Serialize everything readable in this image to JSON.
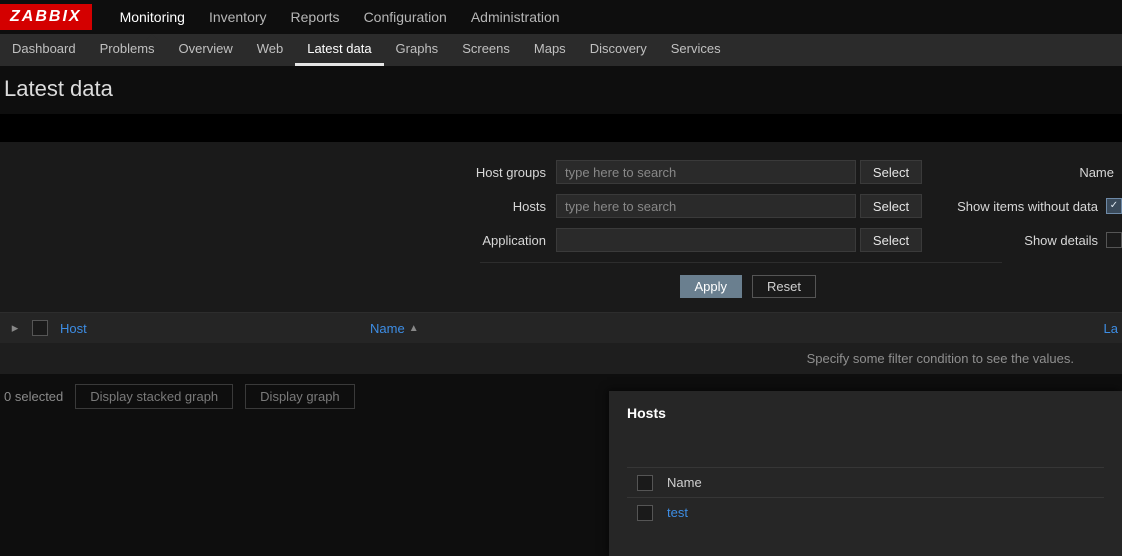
{
  "brand": "ZABBIX",
  "main_nav": {
    "items": [
      "Monitoring",
      "Inventory",
      "Reports",
      "Configuration",
      "Administration"
    ],
    "active_index": 0
  },
  "sub_nav": {
    "items": [
      "Dashboard",
      "Problems",
      "Overview",
      "Web",
      "Latest data",
      "Graphs",
      "Screens",
      "Maps",
      "Discovery",
      "Services"
    ],
    "active_index": 4
  },
  "page_title": "Latest data",
  "filter": {
    "host_groups": {
      "label": "Host groups",
      "placeholder": "type here to search",
      "select": "Select"
    },
    "hosts": {
      "label": "Hosts",
      "placeholder": "type here to search",
      "select": "Select"
    },
    "application": {
      "label": "Application",
      "value": "",
      "select": "Select"
    },
    "name": {
      "label": "Name"
    },
    "show_without_data": {
      "label": "Show items without data",
      "checked": true
    },
    "show_details": {
      "label": "Show details",
      "checked": false
    },
    "apply": "Apply",
    "reset": "Reset"
  },
  "table": {
    "columns": {
      "host": "Host",
      "name": "Name",
      "last": "La"
    },
    "hint": "Specify some filter condition to see the values."
  },
  "footer": {
    "selected": "0 selected",
    "stacked": "Display stacked graph",
    "graph": "Display graph"
  },
  "popup": {
    "title": "Hosts",
    "column": "Name",
    "rows": [
      "test"
    ]
  }
}
